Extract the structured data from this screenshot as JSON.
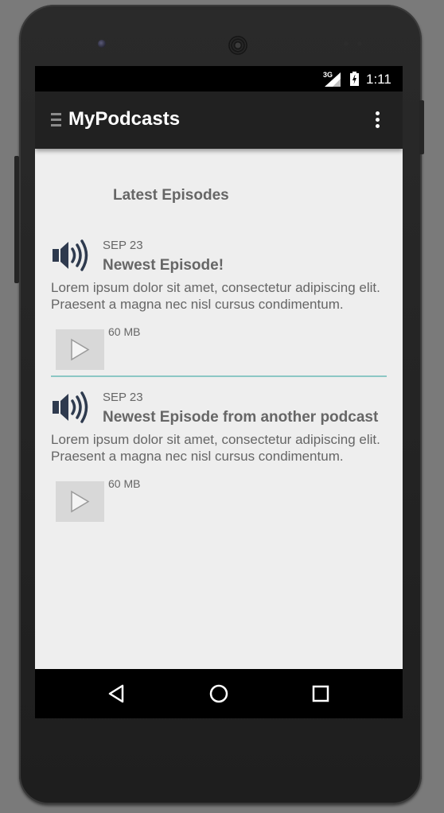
{
  "status_bar": {
    "network": "3G",
    "time": "1:11"
  },
  "app_bar": {
    "title": "MyPodcasts",
    "drawer_icon": "drawer-menu-icon",
    "overflow_icon": "overflow-menu-icon"
  },
  "main": {
    "section_title": "Latest Episodes",
    "episodes": [
      {
        "icon": "speaker-icon",
        "date": "SEP 23",
        "title": "Newest Episode!",
        "description": "Lorem ipsum dolor sit amet, consectetur adipiscing elit. Praesent a magna nec nisl cursus condimentum.",
        "size": "60 MB",
        "play_icon": "play-icon"
      },
      {
        "icon": "speaker-icon",
        "date": "SEP 23",
        "title": "Newest Episode from another podcast",
        "description": "Lorem ipsum dolor sit amet, consectetur adipiscing elit. Praesent a magna nec nisl cursus condimentum.",
        "size": "60 MB",
        "play_icon": "play-icon"
      }
    ]
  },
  "nav_bar": {
    "back_icon": "back-icon",
    "home_icon": "home-icon",
    "recents_icon": "recents-icon"
  },
  "colors": {
    "app_bar": "#212121",
    "background": "#eeeeee",
    "text": "#666666",
    "divider": "#8cc7c4",
    "speaker_icon": "#2e3a4e"
  }
}
